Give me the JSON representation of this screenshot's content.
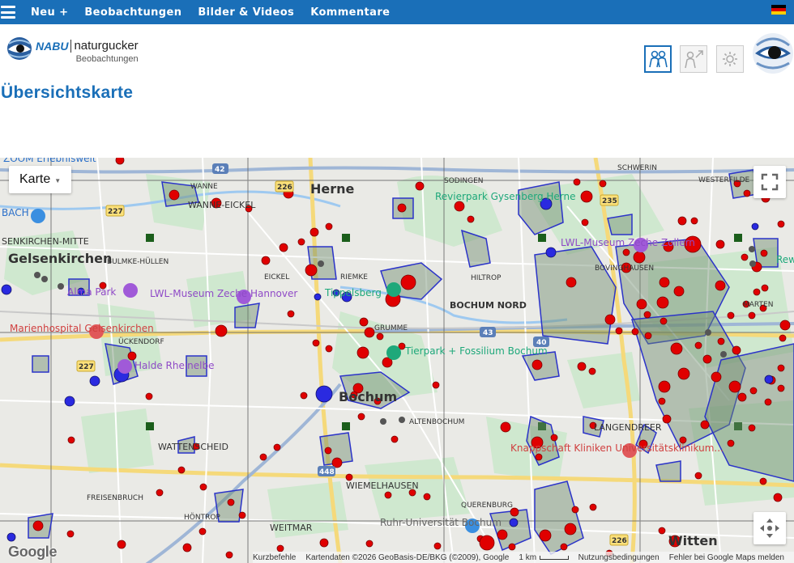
{
  "nav": {
    "new_label": "Neu +",
    "observations_label": "Beobachtungen",
    "media_label": "Bilder & Videos",
    "comments_label": "Kommentare",
    "flag_colors": [
      "#000000",
      "#dd0000",
      "#ffce00"
    ]
  },
  "header": {
    "brand_nabu": "NABU",
    "brand_name": "naturgucker",
    "brand_sub": "Beobachtungen",
    "buttons": [
      "people-icon",
      "person-arrow-icon",
      "gear-icon"
    ]
  },
  "page": {
    "title": "Übersichtskarte"
  },
  "map": {
    "type_label": "Karte",
    "google_logo": "Google",
    "attribution": {
      "shortcuts": "Kurzbefehle",
      "data": "Kartendaten ©2026 GeoBasis-DE/BKG (©2009), Google",
      "scale": "1 km",
      "terms": "Nutzungsbedingungen",
      "report": "Fehler bei Google Maps melden"
    },
    "places": {
      "herne": "Herne",
      "wanne_eickel": "WANNE-EICKEL",
      "eickel": "EICKEL",
      "riemke": "RIEMKE",
      "hiltrop": "HILTROP",
      "bochum_nord": "BOCHUM NORD",
      "bochum": "Bochum",
      "altenbochum": "ALTENBOCHUM",
      "gelsenkirchen": "Gelsenkirchen",
      "gelsenkirchen_mitte": "SENKIRCHEN-MITTE",
      "bulmke": "BULMKE-HÜLLEN",
      "wattenscheid": "WATTENSCHEID",
      "freisenbruch": "FREISENBRUCH",
      "wiemelhausen": "WIEMELHAUSEN",
      "weitmar": "WEITMAR",
      "witten": "Witten",
      "langendreer": "LANGENDREER",
      "sodingen": "SODINGEN",
      "schwerin": "SCHWERIN",
      "westerfilde": "WESTERFILDE",
      "bovinghausen": "BOVINGHAUSEN",
      "querenburg": "QUERENBURG",
      "hontrop": "HÖNTROP",
      "uckendorf": "ÜCKENDORF",
      "marten": "MARTEN",
      "grumme": "GRUMME",
      "wanne": "WANNE",
      "bach": "BACH"
    },
    "pois": {
      "zoom": "ZOOM Erlebniswelt",
      "revierpark": "Revierpark Gysenberg Herne",
      "lwl_zollern": "LWL-Museum Zeche Zollern",
      "amalia": "Alma Park",
      "lwl_hannover": "LWL-Museum Zeche Hannover",
      "tippelsberg": "Tippelsberg",
      "marienhospital": "Marienhospital Gelsenkirchen",
      "halde": "Halde Rheinelbe",
      "tierpark": "Tierpark + Fossilium Bochum",
      "knappschaft": "Knappschaft Kliniken Universitätsklinikum...",
      "ruhr_uni": "Ruhr-Universität Bochum",
      "rewis": "Rewi"
    },
    "roads": [
      "42",
      "226",
      "227",
      "40",
      "43",
      "235",
      "448",
      "227",
      "226"
    ]
  }
}
